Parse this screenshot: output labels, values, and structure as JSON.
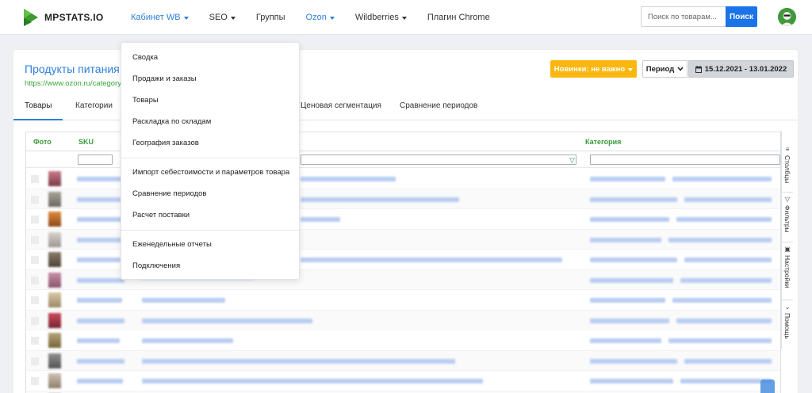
{
  "navbar": {
    "logo_text": "MPSTATS.IO",
    "items": [
      {
        "label": "Кабинет WB",
        "has_caret": true,
        "active": true
      },
      {
        "label": "SEO",
        "has_caret": true,
        "active": false
      },
      {
        "label": "Группы",
        "has_caret": false,
        "active": false
      },
      {
        "label": "Ozon",
        "has_caret": true,
        "active": true
      },
      {
        "label": "Wildberries",
        "has_caret": true,
        "active": false
      },
      {
        "label": "Плагин Chrome",
        "has_caret": false,
        "active": false
      }
    ],
    "search_placeholder": "Поиск по товарам...",
    "search_button": "Поиск",
    "avatar_icon": "user-avatar-icon"
  },
  "header": {
    "title": "Продукты питания",
    "url": "https://www.ozon.ru/category",
    "new_filter_label": "Новинки: не важно",
    "period_label": "Период",
    "date_range": "15.12.2021 - 13.01.2022"
  },
  "tabs": [
    "Товары",
    "Категории",
    "Ценовая сегментация",
    "Сравнение периодов"
  ],
  "grid": {
    "columns": [
      "Фото",
      "SKU",
      "Категория"
    ],
    "filter_icon": "funnel-icon"
  },
  "side_panel": [
    "Столбцы",
    "Фильтры",
    "Настройки",
    "Помощь"
  ],
  "dropdown": {
    "groups": [
      [
        "Сводка",
        "Продажи и заказы",
        "Товары",
        "Раскладка по складам",
        "География заказов"
      ],
      [
        "Импорт себестоимости и параметров товара",
        "Сравнение периодов",
        "Расчет поставки"
      ],
      [
        "Еженедельные отчеты",
        "Подключения"
      ]
    ]
  },
  "colors": {
    "accent_blue": "#2f7fd8",
    "accent_green": "#3a9a3a",
    "button_yellow": "#f9b70f",
    "search_blue": "#1a73e8"
  }
}
